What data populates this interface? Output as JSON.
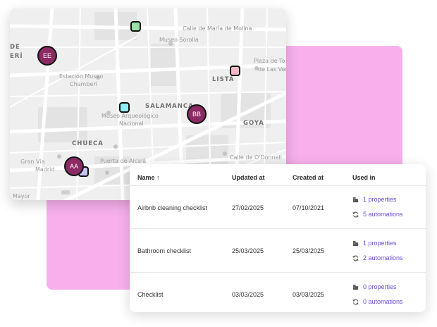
{
  "colors": {
    "accent_pink": "#f7b0ec",
    "marker_fill": "#8c2a63",
    "link": "#6a4bd8",
    "square_green": "#9de0a8",
    "square_pink": "#f2b9c6",
    "square_cyan": "#8ff0f7",
    "square_lavender": "#c9c2f5"
  },
  "map": {
    "labels": {
      "calle_maria_molina": "Calle de María de Molina",
      "museo_sorolla": "Museo Sorolla",
      "plaza_toros": "Plaza de To",
      "las_ventas": "de Las Ver",
      "estacion_museo": "Estación Museo",
      "chamberi": "Chamberí",
      "eri": "ERÍ",
      "de": "DE",
      "lista": "LISTA",
      "salamanca": "SALAMANCA",
      "museo_arqueologico": "Museo Arqueológico",
      "nacional": "Nacional",
      "goya": "GOYA",
      "chueca": "CHUECA",
      "calle_odonnell": "Calle de O'Donnell",
      "puerta_alcala": "Puerta de Alcalá",
      "gran_via": "Gran Vía",
      "madrid": "Madrid",
      "mayor": "Mayor"
    },
    "markers": {
      "ee": "EE",
      "bb": "BB",
      "aa": "AA"
    }
  },
  "table": {
    "headers": {
      "name": "Name ↑",
      "updated": "Updated at",
      "created": "Created at",
      "used": "Used in"
    },
    "rows": [
      {
        "name": "Airbnb cleaning checklist",
        "updated": "27/02/2025",
        "created": "07/10/2021",
        "properties": "1 properties",
        "automations": "5 automations"
      },
      {
        "name": "Bathroom checklist",
        "updated": "25/03/2025",
        "created": "25/03/2025",
        "properties": "1 properties",
        "automations": "2 automations"
      },
      {
        "name": "Checklist",
        "updated": "03/03/2025",
        "created": "03/03/2025",
        "properties": "0 properties",
        "automations": "0 automations"
      }
    ],
    "icons": {
      "properties": "building-icon",
      "automations": "refresh-icon"
    }
  }
}
